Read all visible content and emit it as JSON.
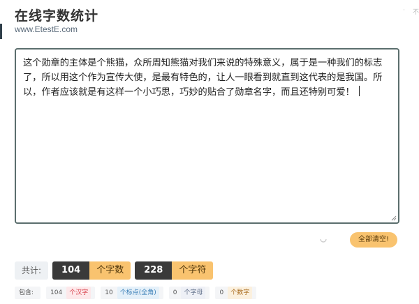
{
  "header": {
    "title": "在线字数统计",
    "site_url": "www.EtestE.com",
    "corner_text": "不"
  },
  "editor": {
    "text": "这个勋章的主体是个熊猫，众所周知熊猫对我们来说的特殊意义，属于是一种我们的标志了，所以用这个作为宣传大使，是最有特色的，让人一眼看到就直到这代表的是我国。所以，作者应该就是有这样一个小巧思，巧妙的贴合了勋章名字，而且还特别可爱！"
  },
  "actions": {
    "clear_label": "全部清空!"
  },
  "totals": {
    "label": "共计:",
    "chars_count": "104",
    "chars_unit": "个字数",
    "symbols_count": "228",
    "symbols_unit": "个字符"
  },
  "details": {
    "label": "包含:",
    "items": [
      {
        "count": "104",
        "unit": "个汉字"
      },
      {
        "count": "10",
        "unit": "个标点(全角)"
      },
      {
        "count": "0",
        "unit": "个字母"
      },
      {
        "count": "0",
        "unit": "个数字"
      }
    ]
  },
  "colors": {
    "accent": "#f9c36f",
    "dark": "#3a3a3a",
    "border": "#5b6e6d"
  }
}
